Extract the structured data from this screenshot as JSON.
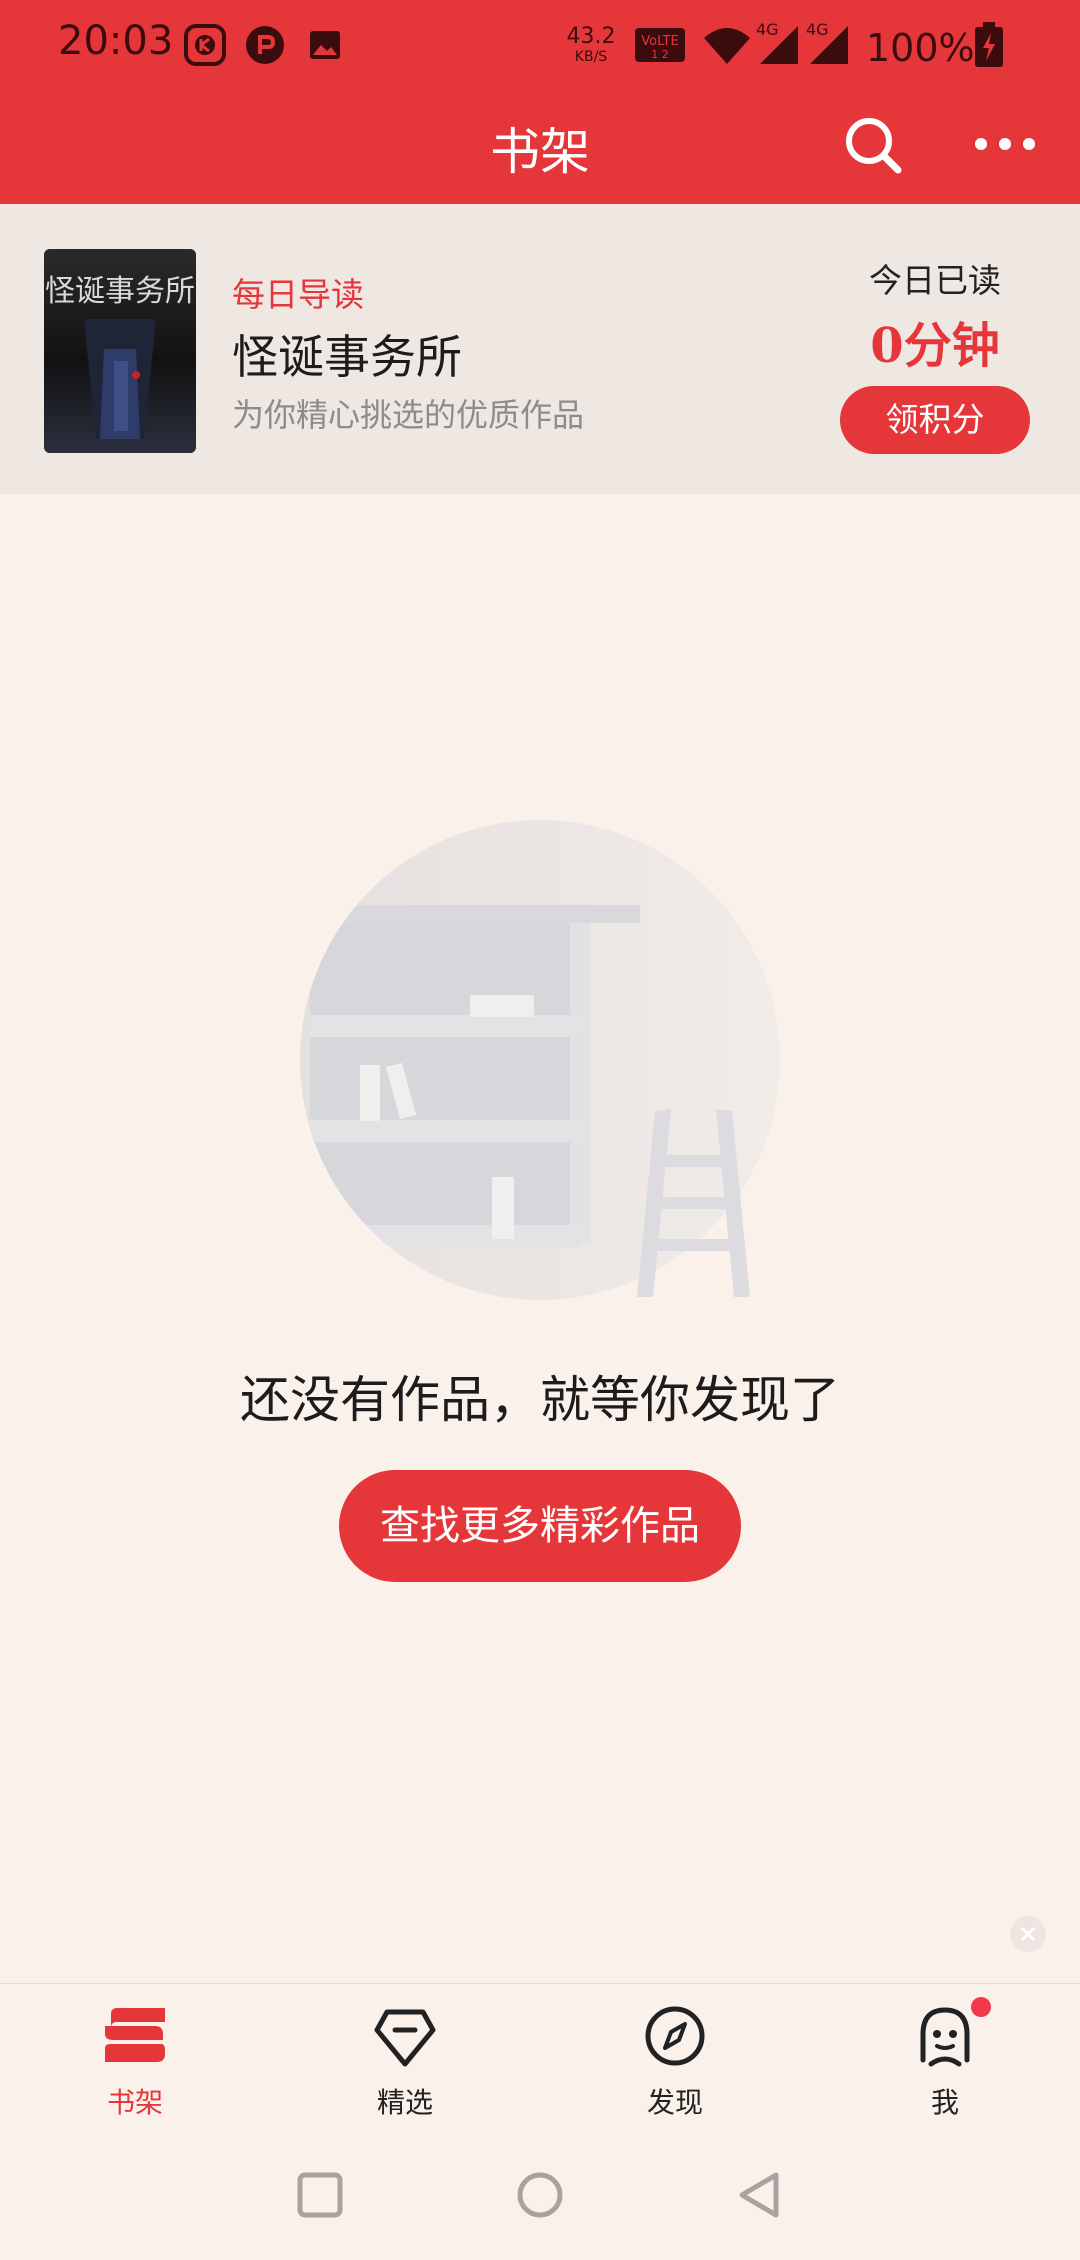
{
  "status_bar": {
    "time": "20:03",
    "net_speed_value": "43.2",
    "net_speed_unit": "KB/S",
    "volte_text": "Vo LTE",
    "sim1_label": "4G",
    "sim2_label": "4G",
    "battery": "100%",
    "icons": [
      "kuaishou-app-icon",
      "app-r-icon",
      "gallery-icon",
      "volte-icon",
      "wifi-icon",
      "signal-icon",
      "battery-charging-icon"
    ]
  },
  "header": {
    "title": "书架",
    "icons": [
      "search-icon",
      "more-icon"
    ]
  },
  "daily_card": {
    "tag": "每日导读",
    "book_title": "怪诞事务所",
    "description": "为你精心挑选的优质作品",
    "cover_title_text": "怪诞事务所",
    "today_label": "今日已读",
    "today_value": "0分钟",
    "points_button": "领积分"
  },
  "empty_state": {
    "message": "还没有作品，就等你发现了",
    "button": "查找更多精彩作品"
  },
  "tabs": [
    {
      "label": "书架",
      "icon": "bookshelf-icon",
      "active": true
    },
    {
      "label": "精选",
      "icon": "diamond-icon",
      "active": false
    },
    {
      "label": "发现",
      "icon": "compass-icon",
      "active": false
    },
    {
      "label": "我",
      "icon": "profile-face-icon",
      "active": false
    }
  ],
  "colors": {
    "brand_red": "#e5373a",
    "page_bg": "#faf1eb",
    "card_bg": "#efe7e2"
  }
}
